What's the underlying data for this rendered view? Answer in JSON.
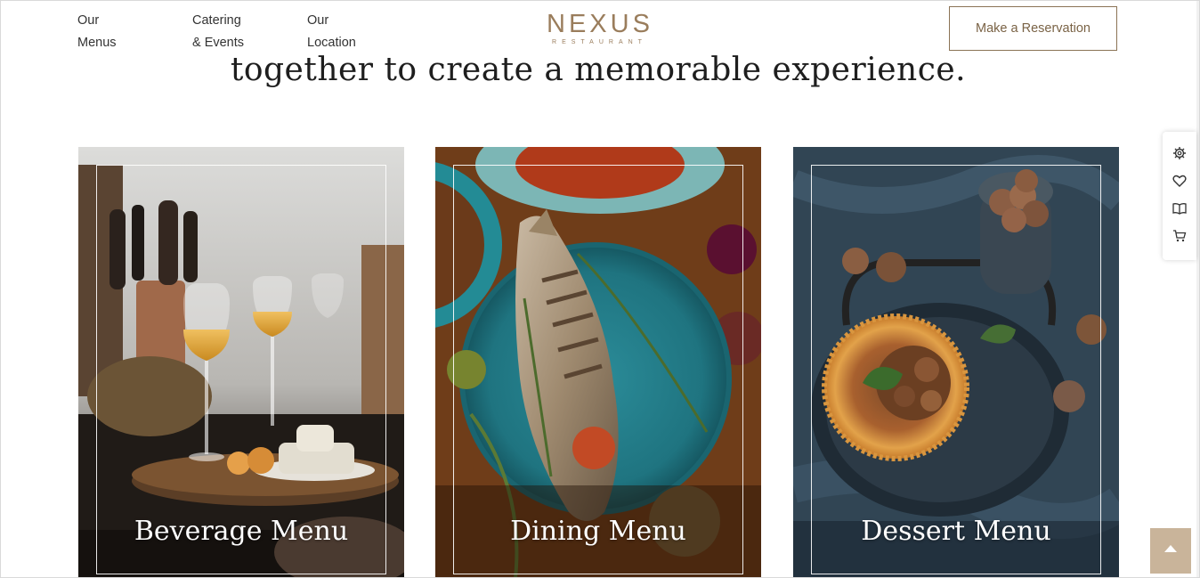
{
  "header": {
    "nav": [
      {
        "line1": "Our",
        "line2": "Menus"
      },
      {
        "line1": "Catering",
        "line2": "& Events"
      },
      {
        "line1": "Our",
        "line2": "Location"
      }
    ],
    "logo": {
      "name": "NEXUS",
      "subtitle": "RESTAURANT"
    },
    "reservation_label": "Make a Reservation"
  },
  "headline": "together to create a memorable experience.",
  "cards": [
    {
      "title": "Beverage Menu",
      "image": "wine-and-cheese-photo"
    },
    {
      "title": "Dining Menu",
      "image": "fish-on-plate-photo"
    },
    {
      "title": "Dessert Menu",
      "image": "tart-with-walnuts-photo"
    }
  ],
  "tools": [
    "gear-icon",
    "heart-icon",
    "book-icon",
    "cart-icon"
  ],
  "colors": {
    "brand": "#9a7d5c",
    "button_border": "#8b7355",
    "scroll_top": "#c9b49a"
  }
}
